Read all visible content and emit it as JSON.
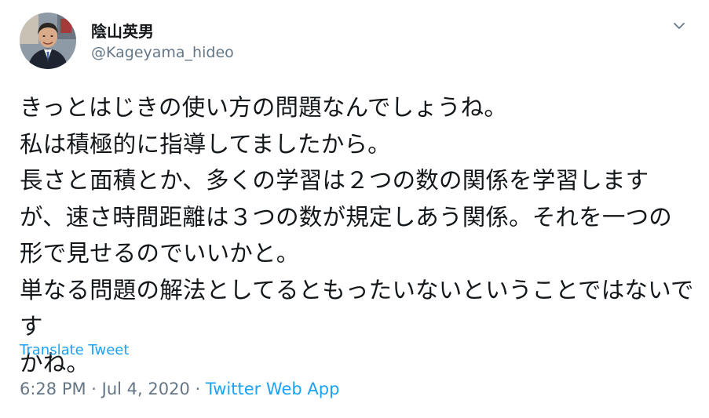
{
  "author": {
    "display_name": "陰山英男",
    "handle": "@Kageyama_hideo"
  },
  "tweet": {
    "lines": [
      "きっとはじきの使い方の問題なんでしょうね。",
      "私は積極的に指導してましたから。",
      "長さと面積とか、多くの学習は２つの数の関係を学習します",
      "が、速さ時間距離は３つの数が規定しあう関係。それを一つの",
      "形で見せるのでいいかと。",
      "単なる問題の解法としてるともったいないということではないです",
      "かね。"
    ],
    "translate_label": "Translate Tweet",
    "time": "6:28 PM",
    "separator": " · ",
    "date": "Jul 4, 2020",
    "source": "Twitter Web App"
  },
  "icons": {
    "menu": "chevron-down-icon",
    "avatar": "profile-photo"
  },
  "colors": {
    "accent": "#1da1f2",
    "text": "#14171a",
    "secondary": "#657786"
  }
}
